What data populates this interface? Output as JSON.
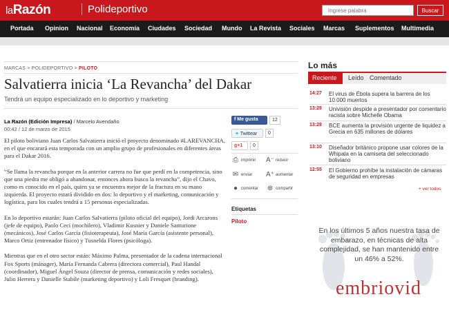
{
  "header": {
    "logo_prefix": "la",
    "logo_name": "Razón",
    "section": "Polideportivo",
    "search_placeholder": "Ingrese palabra",
    "search_button": "Buscar"
  },
  "nav": [
    "Portada",
    "Opinion",
    "Nacional",
    "Economía",
    "Ciudades",
    "Sociedad",
    "Mundo",
    "La Revista",
    "Sociales",
    "Marcas",
    "Suplementos",
    "Multimedia"
  ],
  "breadcrumb": {
    "items": [
      "MARCAS",
      "POLIDEPORTIVO"
    ],
    "current": "PILOTO",
    "sep": ">"
  },
  "article": {
    "title": "Salvatierra inicia ‘La Revancha’ del Dakar",
    "subtitle": "Tendrá un equipo especializado en lo deportivo y marketing",
    "source": "La Razón (Edición Impresa)",
    "author": "/ Marcelo Avendaño",
    "date": "00:42 / 12 de marzo de 2015",
    "paragraphs": [
      "El piloto boliviano Juan Carlos Salvatierra inició el proyecto denominado #LAREVANCHA, en el que encarará esta temporada con un amplio grupo de profesionales en diferentes áreas para el Dakar 2016.",
      "“Se llama la revancha porque en la anterior carrera no fue que perdí en la competencia, sino que una piedra me obligó a abandonar, entonces ahora busco la revancha”, dijo el Chavo, como es conocido en el país, quien ya se encuentra mejor de la fractura en su mano izquierda. El proyecto estará dividido en dos: lo deportivo y el marketing, comunicación y logística, para los cuales tendrá a 15 personas especializadas.",
      "En lo deportivo estarán: Juan Carlos Salvatierra (piloto oficial del equipo), Jordi Arcarons (jefe de equipo), Paolo Ceci (mochilero), Vladimir Kusnier y Daniele Santurione (mecánicos), José Carlos García (fisioterapeuta), José María García (asistente personal), Marco Ortiz (entrenador físico) y Tusnelda Flores (psicóloga).",
      "Mientras que en el otro sector están: Máximo Palma, presentador de la cadena internacional Fox Sports (mánager), María Fernanda Cabrera (directora comercial), Paul Handal (coordinador), Miguel Ángel Souza (director de prensa, comunicación y redes sociales), Julio Herrera y Danielle Stabile (marketing deportivo) y Loli Fresquet (branding)."
    ]
  },
  "share": {
    "fb_label": "Me gusta",
    "fb_count": "12",
    "tw_label": "Twittear",
    "tw_count": "0",
    "gp_label": "g+1",
    "gp_count": "0",
    "tools": [
      "imprimir",
      "reducir",
      "enviar",
      "aumentar",
      "comentar",
      "compartir"
    ],
    "tags_title": "Etiquetas",
    "tag": "Piloto"
  },
  "sidebar": {
    "title": "Lo más",
    "tabs": [
      "Reciente",
      "Leído",
      "Comentado"
    ],
    "news": [
      {
        "time": "14:27",
        "text": "El virus de Ébola supera la barrera de los 10.000 muertos"
      },
      {
        "time": "13:28",
        "text": "Univisión despide a presentador por comentario racista sobre Michelle Obama"
      },
      {
        "time": "13:28",
        "text": "BCE aumenta la provisión urgente de liquidez a Grecia en 635 millones de dólares"
      },
      {
        "time": "13:10",
        "text": "Diseñador británico propone usar colores de la Whipala en la camiseta del seleccionado boliviano"
      },
      {
        "time": "12:55",
        "text": "El Gobierno prohíbe la instalación de cámaras de seguridad en empresas"
      }
    ],
    "more": "+ ver todos"
  },
  "ad": {
    "text": "En los últimos 5 años nuestra tasa de embarazo, en técnicas de alta complejidad, se han mantenido entre un 46% a 52%.",
    "brand": "embriovid"
  },
  "colors": {
    "brand_red": "#c8181e",
    "nav_black": "#1b1b1b",
    "facebook": "#3b5998"
  }
}
